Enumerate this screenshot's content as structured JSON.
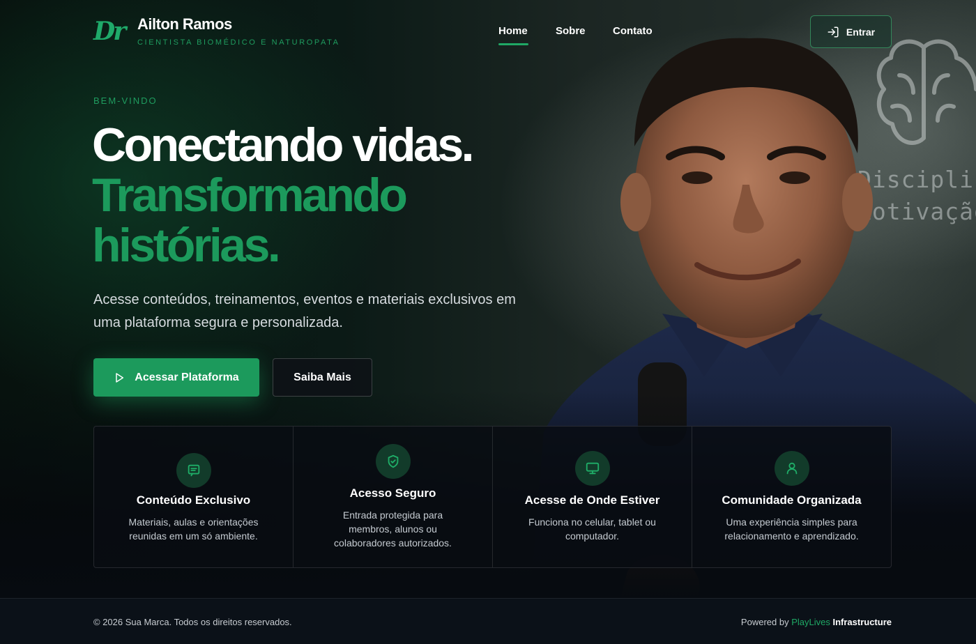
{
  "brand": {
    "mark": "Dr",
    "name": "Ailton Ramos",
    "subtitle": "CIENTISTA BIOMÉDICO E NATUROPATA"
  },
  "nav": {
    "items": [
      {
        "label": "Home",
        "active": true
      },
      {
        "label": "Sobre",
        "active": false
      },
      {
        "label": "Contato",
        "active": false
      }
    ],
    "login_label": "Entrar"
  },
  "hero": {
    "eyebrow": "BEM-VINDO",
    "headline_1": "Conectando vidas.",
    "headline_2": "Transformando",
    "headline_3": "histórias.",
    "lead": "Acesse conteúdos, treinamentos, eventos e materiais exclusivos em uma plataforma segura e personalizada.",
    "primary_cta": "Acessar Plataforma",
    "secondary_cta": "Saiba Mais"
  },
  "background_text": {
    "line_1": "Disciplin",
    "line_2": "Motivação"
  },
  "features": [
    {
      "icon": "message-square-icon",
      "title": "Conteúdo Exclusivo",
      "desc": "Materiais, aulas e orientações reunidas em um só ambiente."
    },
    {
      "icon": "shield-check-icon",
      "title": "Acesso Seguro",
      "desc": "Entrada protegida para membros, alunos ou colaboradores autorizados."
    },
    {
      "icon": "monitor-icon",
      "title": "Acesse de Onde Estiver",
      "desc": "Funciona no celular, tablet ou computador."
    },
    {
      "icon": "user-icon",
      "title": "Comunidade Organizada",
      "desc": "Uma experiência simples para relacionamento e aprendizado."
    }
  ],
  "footer": {
    "copyright": "© 2026 Sua Marca. Todos os direitos reservados.",
    "powered_prefix": "Powered by",
    "powered_brand": "PlayLives",
    "powered_suffix": "Infrastructure"
  },
  "colors": {
    "accent": "#1c9a5c",
    "background": "#0a0f14",
    "icon_circle": "#123b2a"
  }
}
